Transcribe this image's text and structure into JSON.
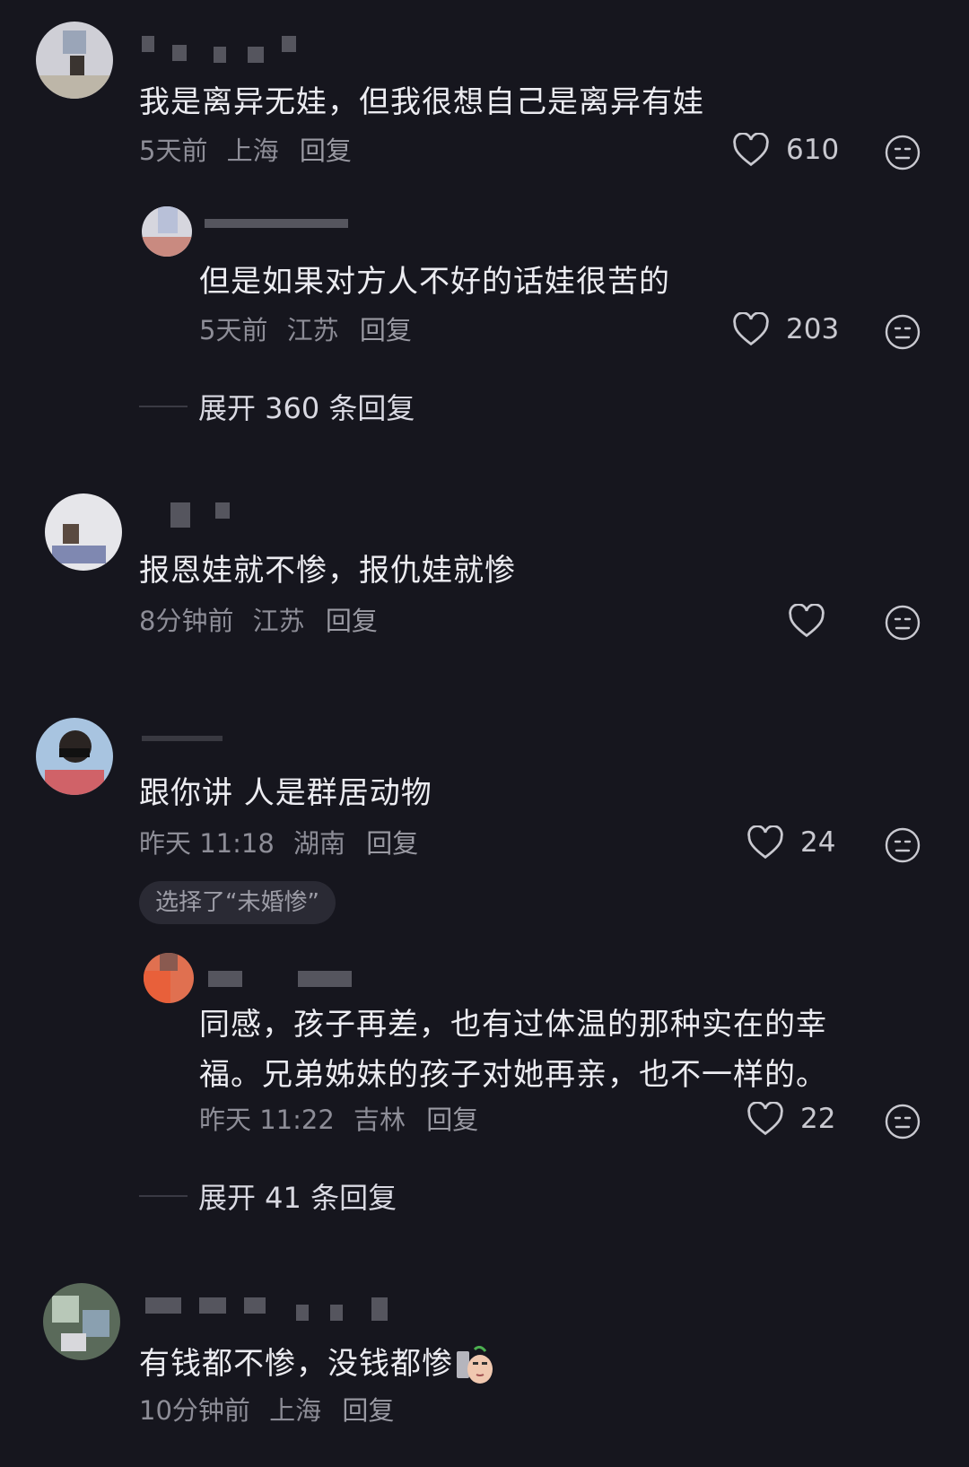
{
  "comments": [
    {
      "text": "我是离异无娃，但我很想自己是离异有娃",
      "time": "5天前",
      "location": "上海",
      "reply_label": "回复",
      "likes": "610"
    },
    {
      "text": "但是如果对方人不好的话娃很苦的",
      "time": "5天前",
      "location": "江苏",
      "reply_label": "回复",
      "likes": "203"
    },
    {
      "text": "报恩娃就不惨，报仇娃就惨",
      "time": "8分钟前",
      "location": "江苏",
      "reply_label": "回复"
    },
    {
      "text": "跟你讲 人是群居动物",
      "time": "昨天 11:18",
      "location": "湖南",
      "reply_label": "回复",
      "likes": "24",
      "choice": "选择了“未婚惨”"
    },
    {
      "text_line1": "同感，孩子再差，也有过体温的那种实在的幸",
      "text_line2": "福。兄弟姊妹的孩子对她再亲，也不一样的。",
      "time": "昨天 11:22",
      "location": "吉林",
      "reply_label": "回复",
      "likes": "22"
    },
    {
      "text": "有钱都不惨，没钱都惨",
      "time": "10分钟前",
      "location": "上海",
      "reply_label": "回复"
    }
  ],
  "expand_1": "展开 360 条回复",
  "expand_2": "展开 41 条回复",
  "colors": {
    "background": "#16161e",
    "meta": "#8d8d97",
    "text": "#ececf1"
  },
  "icons": [
    "heart-icon",
    "meh-face-icon",
    "avatar",
    "sticker"
  ]
}
